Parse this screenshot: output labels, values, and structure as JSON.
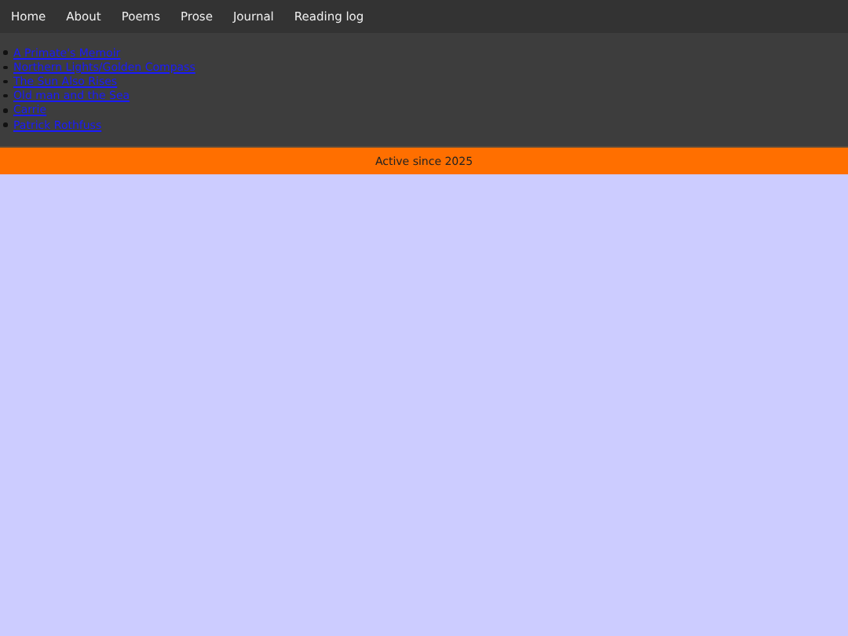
{
  "nav": [
    "Home",
    "About",
    "Poems",
    "Prose",
    "Journal",
    "Reading log"
  ],
  "links": [
    "A Primate's Memoir",
    "Northern Lights/Golden Compass",
    "The Sun Also Rises",
    "Old man and the Sea",
    "Carrie",
    "Patrick Rothfuss"
  ],
  "footer": "Active since 2025"
}
